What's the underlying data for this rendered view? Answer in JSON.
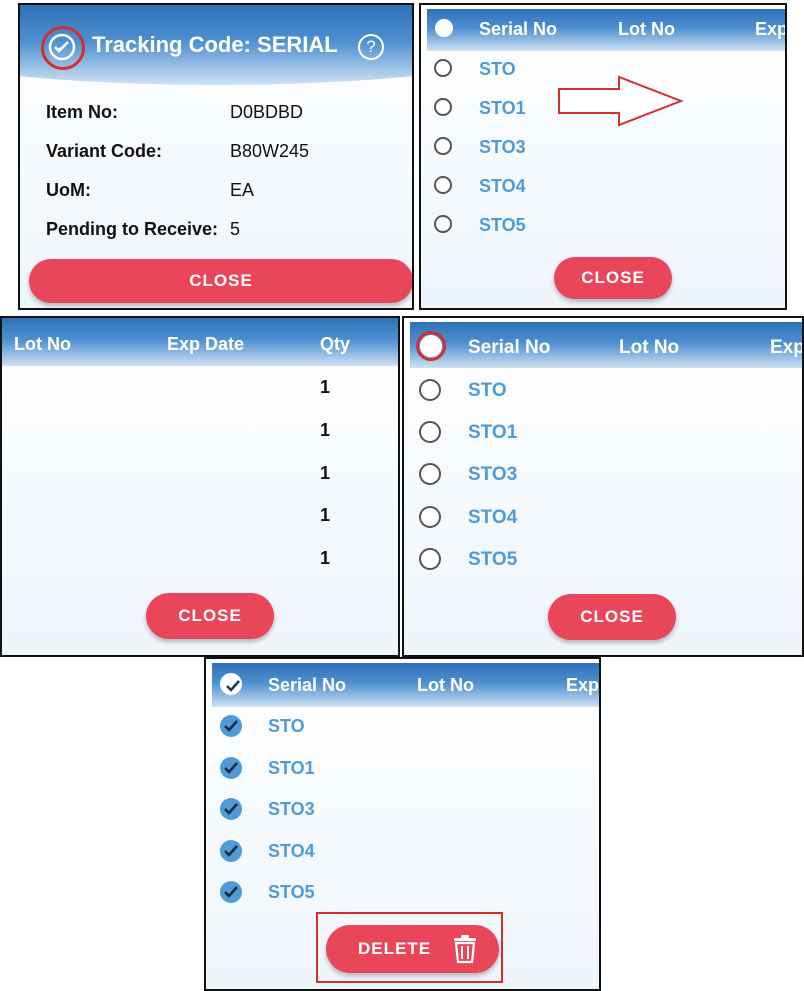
{
  "p1": {
    "title": "Tracking Code: SERIAL",
    "help": "?",
    "rows": [
      {
        "label": "Item No:",
        "value": "D0BDBD"
      },
      {
        "label": "Variant Code:",
        "value": "B80W245"
      },
      {
        "label": "UoM:",
        "value": "EA"
      },
      {
        "label": "Pending to Receive:",
        "value": "5"
      }
    ],
    "close": "CLOSE"
  },
  "list_header": {
    "serial": "Serial No",
    "lot": "Lot No",
    "exp": "Exp"
  },
  "serials": [
    "STO",
    "STO1",
    "STO3",
    "STO4",
    "STO5"
  ],
  "p2": {
    "close": "CLOSE"
  },
  "p3": {
    "header": {
      "lot": "Lot No",
      "exp": "Exp Date",
      "qty": "Qty"
    },
    "qtys": [
      "1",
      "1",
      "1",
      "1",
      "1"
    ],
    "close": "CLOSE"
  },
  "p4": {
    "close": "CLOSE"
  },
  "p5": {
    "delete": "DELETE"
  },
  "colors": {
    "accent_red": "#e9465a",
    "header_blue": "#2f71b8",
    "serial_blue": "#4e9bd6",
    "annotation_red": "#d32f2f"
  }
}
